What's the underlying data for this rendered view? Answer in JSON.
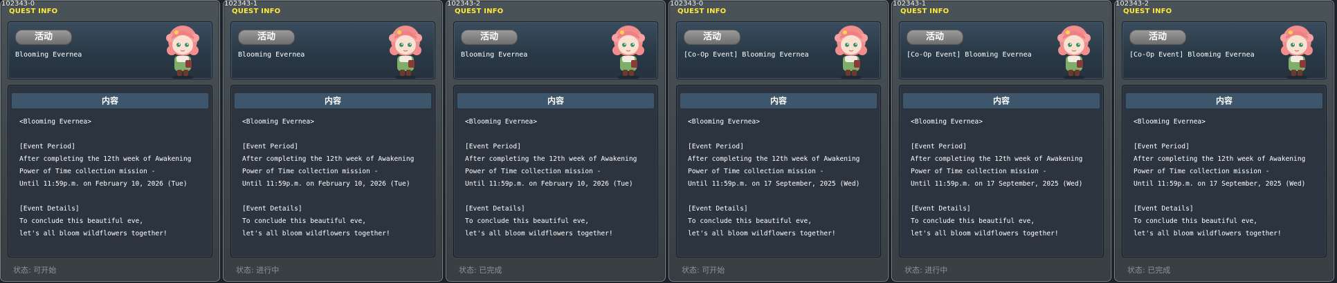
{
  "labels": {
    "heading": "QUEST INFO",
    "tag": "活动",
    "section": "内容",
    "status_prefix": "状态:"
  },
  "panels": [
    {
      "id": "102343-0",
      "quest_title": "Blooming Evernea",
      "content_lines": [
        "<Blooming Evernea>",
        "",
        "[Event Period]",
        "After completing the 12th week of Awakening",
        "Power of Time collection mission -",
        "Until 11:59p.m. on February 10, 2026 (Tue)",
        "",
        "[Event Details]",
        "To conclude this beautiful eve,",
        "let's all bloom wildflowers together!"
      ],
      "status": "可开始"
    },
    {
      "id": "102343-1",
      "quest_title": "Blooming Evernea",
      "content_lines": [
        "<Blooming Evernea>",
        "",
        "[Event Period]",
        "After completing the 12th week of Awakening",
        "Power of Time collection mission -",
        "Until 11:59p.m. on February 10, 2026 (Tue)",
        "",
        "[Event Details]",
        "To conclude this beautiful eve,",
        "let's all bloom wildflowers together!"
      ],
      "status": "进行中"
    },
    {
      "id": "102343-2",
      "quest_title": "Blooming Evernea",
      "content_lines": [
        "<Blooming Evernea>",
        "",
        "[Event Period]",
        "After completing the 12th week of Awakening",
        "Power of Time collection mission -",
        "Until 11:59p.m. on February 10, 2026 (Tue)",
        "",
        "[Event Details]",
        "To conclude this beautiful eve,",
        "let's all bloom wildflowers together!"
      ],
      "status": "已完成"
    },
    {
      "id": "102343-0",
      "quest_title": "[Co-Op Event] Blooming Evernea",
      "content_lines": [
        "<Blooming Evernea>",
        "",
        "[Event Period]",
        "After completing the 12th week of Awakening",
        "Power of Time collection mission -",
        "Until 11:59p.m. on 17 September, 2025 (Wed)",
        "",
        "[Event Details]",
        "To conclude this beautiful eve,",
        "let's all bloom wildflowers together!"
      ],
      "status": "可开始"
    },
    {
      "id": "102343-1",
      "quest_title": "[Co-Op Event] Blooming Evernea",
      "content_lines": [
        "<Blooming Evernea>",
        "",
        "[Event Period]",
        "After completing the 12th week of Awakening",
        "Power of Time collection mission -",
        "Until 11:59p.m. on 17 September, 2025 (Wed)",
        "",
        "[Event Details]",
        "To conclude this beautiful eve,",
        "let's all bloom wildflowers together!"
      ],
      "status": "进行中"
    },
    {
      "id": "102343-2",
      "quest_title": "[Co-Op Event] Blooming Evernea",
      "content_lines": [
        "<Blooming Evernea>",
        "",
        "[Event Period]",
        "After completing the 12th week of Awakening",
        "Power of Time collection mission -",
        "Until 11:59p.m. on 17 September, 2025 (Wed)",
        "",
        "[Event Details]",
        "To conclude this beautiful eve,",
        "let's all bloom wildflowers together!"
      ],
      "status": "已完成"
    }
  ],
  "colors": {
    "heading": "#ffea3a",
    "status_text": "#8b9498",
    "section_bar": "#3d566b"
  },
  "portrait_icon": "npc-portrait-pink-haired-girl"
}
